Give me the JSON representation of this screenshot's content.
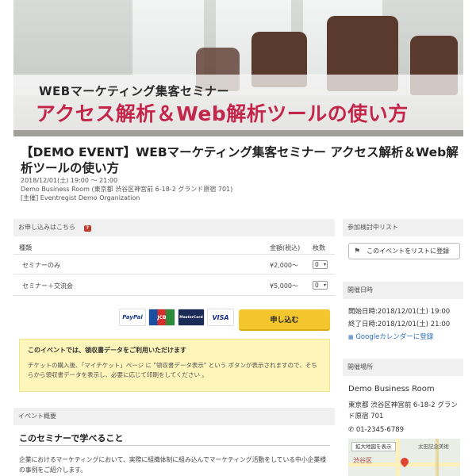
{
  "hero": {
    "subtitle": "WEBマーケティング集客セミナー",
    "title": "アクセス解析＆Web解析ツールの使い方"
  },
  "event": {
    "title": "【DEMO EVENT】WEBマーケティング集客セミナー アクセス解析＆Web解析ツールの使い方",
    "datetime": "2018/12/01(土) 19:00 〜 21:00",
    "venue": "Demo Business Room (東京都 渋谷区神宮前 6-18-2 グランド原宿 701)",
    "organizer": "[主催] Eventregist Demo Organization"
  },
  "apply": {
    "header": "お申し込みはこちら",
    "help_icon": "?",
    "col_type": "種類",
    "col_price": "金額(税込)",
    "col_qty": "枚数",
    "tickets": [
      {
        "name": "セミナーのみ",
        "price": "¥2,000〜",
        "qty": "0"
      },
      {
        "name": "セミナー＋交流会",
        "price": "¥5,000〜",
        "qty": "0"
      }
    ],
    "cards": [
      "PayPal",
      "JCB",
      "MasterCard",
      "VISA"
    ],
    "button": "申し込む",
    "notice_title": "このイベントでは、領収書データをご利用いただけます",
    "notice_body": "チケットの購入後、「マイチケット」ページ に \"領収書データ表示\" という ボタンが表示されますので、そちらから領収書データを表示し、必要に応じて印刷をしてください 。"
  },
  "overview": {
    "header": "イベント概要",
    "heading": "このセミナーで学べること",
    "body": "企業におけるマーケティングにおいて、実際に組織体制に組み込んでマーケティング活動をしている中小企業様の事例をご紹介します。"
  },
  "sidebar": {
    "wishlist_header": "参加検討中リスト",
    "wishlist_button": "このイベントをリストに登録",
    "schedule_header": "開催日時",
    "start": "開始日時:2018/12/01(土) 19:00",
    "end": "終了日時:2018/12/01(土) 21:00",
    "gcal": "Googleカレンダーに登録",
    "place_header": "開催場所",
    "place_name": "Demo Business Room",
    "place_address": "東京都 渋谷区神宮前 6-18-2 グランド原宿 701",
    "phone": "01-2345-6789",
    "map_button": "拡大地図を表示",
    "map_label": "太田記念美術",
    "map_city": "渋谷区"
  },
  "colors": {
    "accent": "#c3264a",
    "button": "#f3c62d",
    "notice": "#fdf5b9",
    "panel": "#f0f0f0"
  }
}
